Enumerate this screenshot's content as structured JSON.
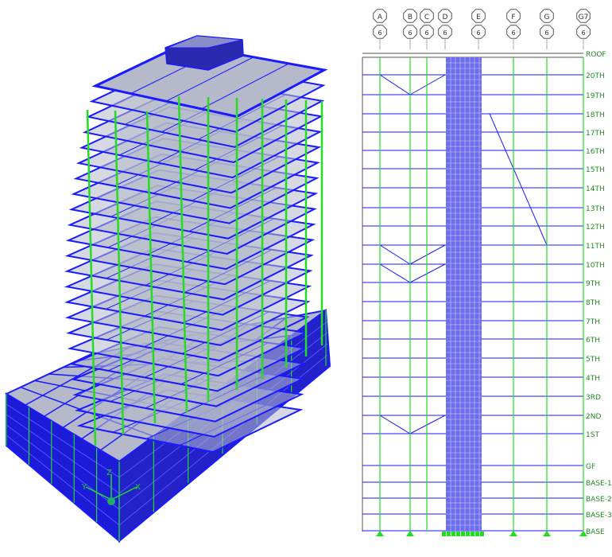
{
  "left_panel": {
    "axis_labels": {
      "x": "X",
      "y": "Y",
      "z": "Z"
    }
  },
  "elevation": {
    "grid_lines": [
      {
        "label": "A",
        "sub": "6"
      },
      {
        "label": "B",
        "sub": "6"
      },
      {
        "label": "C",
        "sub": "6"
      },
      {
        "label": "D",
        "sub": "6"
      },
      {
        "label": "E",
        "sub": "6"
      },
      {
        "label": "F",
        "sub": "6"
      },
      {
        "label": "G",
        "sub": "6"
      },
      {
        "label": "G7",
        "sub": "6"
      }
    ],
    "levels": [
      "ROOF",
      "20TH",
      "19TH",
      "18TH",
      "17TH",
      "16TH",
      "15TH",
      "14TH",
      "13TH",
      "12TH",
      "11TH",
      "10TH",
      "9TH",
      "8TH",
      "7TH",
      "6TH",
      "5TH",
      "4TH",
      "3RD",
      "2ND",
      "1ST",
      "GF",
      "BASE-1",
      "BASE-2",
      "BASE-3",
      "BASE"
    ],
    "colors": {
      "frame": "#1a1aff",
      "column": "#22dd22",
      "slab": "#6d6df0",
      "grid": "#555555"
    }
  }
}
